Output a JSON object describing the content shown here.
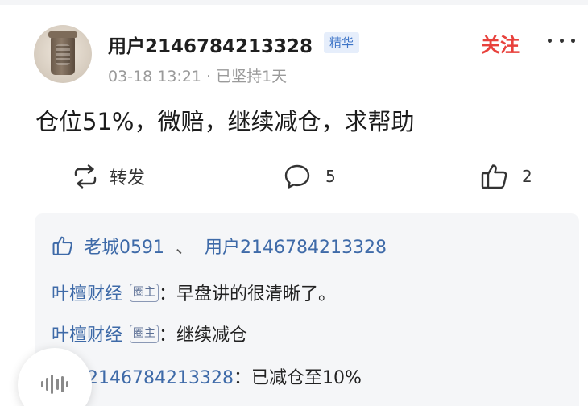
{
  "post": {
    "author": {
      "username": "用户2146784213328",
      "badge": "精华",
      "avatar_icon": "pottery-jar-avatar"
    },
    "timestamp": "03-18 13:21",
    "streak": "已坚持1天",
    "follow_label": "关注",
    "more_icon": "more-dots-icon",
    "content": "仓位51%，微赔，继续减仓，求帮助",
    "actions": {
      "repost_label": "转发",
      "comment_count": "5",
      "like_count": "2"
    }
  },
  "comments_panel": {
    "liked_by": [
      "老城0591",
      "用户2146784213328"
    ],
    "liked_sep": "、",
    "comments": [
      {
        "author": "叶檀财经",
        "tag": "圈主",
        "colon": "：",
        "text": "早盘讲的很清晰了。"
      },
      {
        "author": "叶檀财经",
        "tag": "圈主",
        "colon": "：",
        "text": "继续减仓"
      },
      {
        "author": "用户2146784213328",
        "tag": "",
        "colon": "：",
        "text": "已减仓至10%"
      }
    ]
  },
  "colors": {
    "accent_red": "#e8413c",
    "link_blue": "#3e6aa8",
    "badge_blue": "#3d74c7",
    "panel_bg": "#f5f6f8"
  }
}
